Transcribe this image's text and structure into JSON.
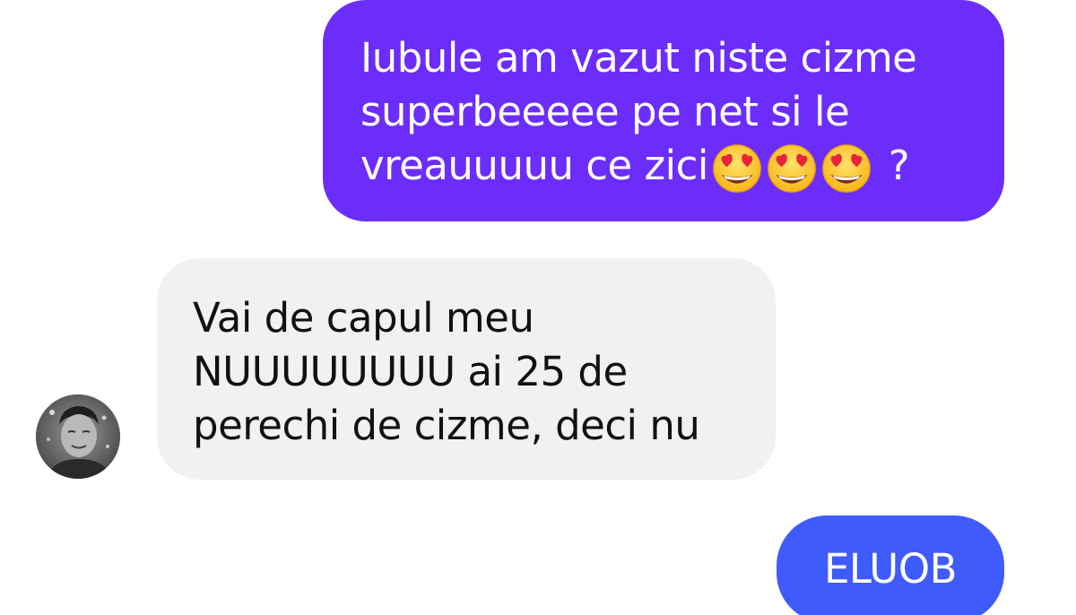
{
  "conversation": {
    "messages": [
      {
        "direction": "outgoing",
        "lines": [
          "Iubule am vazut niste cizme",
          "superbeeeee pe net si le",
          "vreauuuuu ce zici"
        ],
        "emoji": [
          "heart-eyes",
          "heart-eyes",
          "heart-eyes"
        ],
        "suffix": " ?",
        "color": "#6c2dfb"
      },
      {
        "direction": "incoming",
        "lines": [
          "Vai de capul meu",
          "NUUUUUUUU ai 25 de",
          "perechi de cizme, deci nu"
        ],
        "color": "#f1f1f1"
      },
      {
        "direction": "outgoing",
        "lines": [
          "ELUOB"
        ],
        "color": "#3f5bfb"
      }
    ],
    "contact": {
      "avatar_icon": "person-avatar"
    }
  }
}
